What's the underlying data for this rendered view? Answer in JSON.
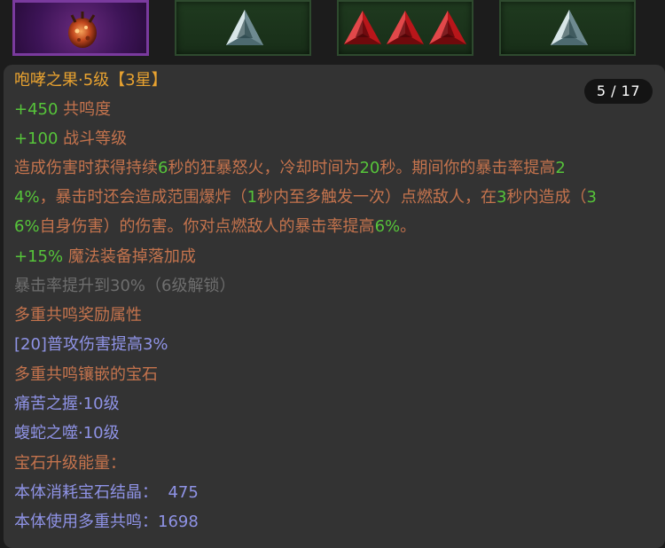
{
  "pager": "5 / 17",
  "title": "咆哮之果·5级【3星】",
  "stats": [
    {
      "value": "+450",
      "label": " 共鸣度"
    },
    {
      "value": "+100",
      "label": " 战斗等级"
    }
  ],
  "desc": {
    "l1": [
      "造成伤害时获得持续",
      "6",
      "秒的狂暴怒火，冷却时间为",
      "20",
      "秒。期间你的暴击率提高",
      "2"
    ],
    "l2": [
      "4%",
      "，暴击时还会造成范围爆炸（",
      "1",
      "秒内至多触发一次）点燃敌人，在",
      "3",
      "秒内造成（",
      "3"
    ],
    "l3": [
      "6%",
      "自身伤害）的伤害。你对点燃敌人的暴击率提高",
      "6%",
      "。"
    ]
  },
  "drop_bonus": {
    "value": "+15%",
    "label": " 魔法装备掉落加成"
  },
  "locked": "暴击率提升到30%（6级解锁）",
  "multi_heading": "多重共鸣奖励属性",
  "multi_bonus": "[20]普攻伤害提高3%",
  "inlaid_heading": "多重共鸣镶嵌的宝石",
  "gems": [
    "痛苦之握·10级",
    "蝮蛇之噬·10级"
  ],
  "upgrade_heading": "宝石升级能量：",
  "energy": [
    {
      "label": "本体消耗宝石结晶：",
      "value": "475"
    },
    {
      "label": "本体使用多重共鸣：",
      "value": "1698"
    }
  ],
  "colors": {
    "title": "#e8a230",
    "green": "#56c43a",
    "tan": "#c4734d",
    "grey": "#6e6e6e",
    "blue": "#8f93e6"
  },
  "icons": [
    "fruit-gem-icon",
    "silver-triangle-gem-icon",
    "red-triangle-gem-icon"
  ]
}
